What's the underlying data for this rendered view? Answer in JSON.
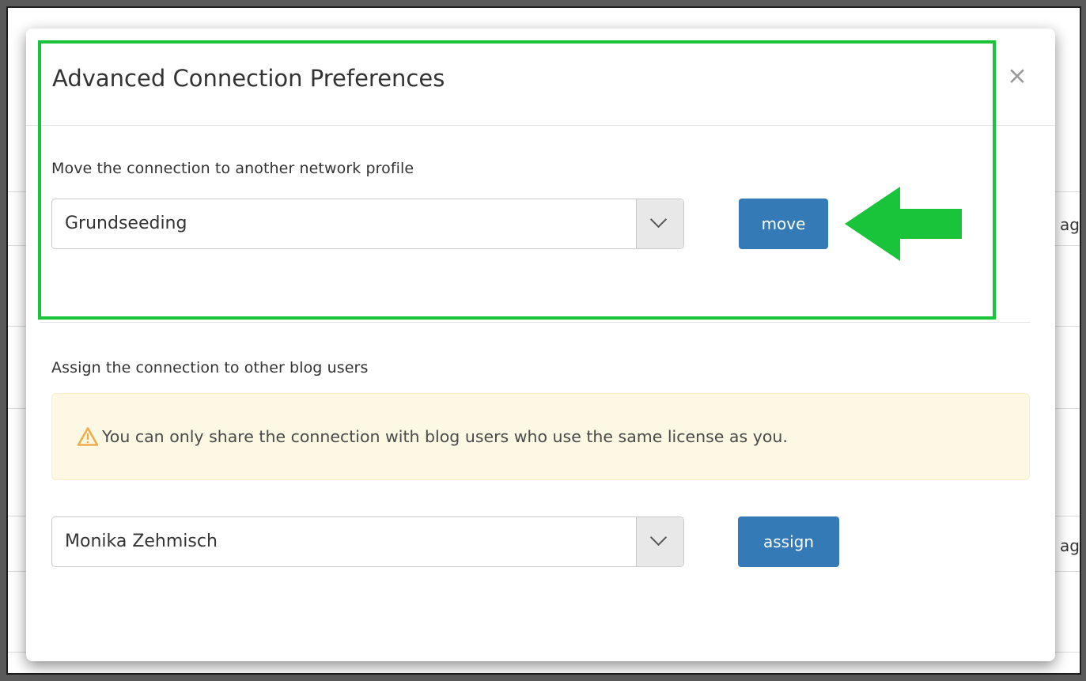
{
  "modal": {
    "title": "Advanced Connection Preferences",
    "close_label": "×"
  },
  "move_section": {
    "label": "Move the connection to another network profile",
    "selected_profile": "Grundseeding",
    "button_label": "move"
  },
  "assign_section": {
    "label": "Assign the connection to other blog users",
    "warning_text": "You can only share the connection with blog users who use the same license as you.",
    "selected_user": "Monika Zehmisch",
    "button_label": "assign"
  },
  "background": {
    "partial_text_1": "ag",
    "partial_text_2": "ag"
  },
  "colors": {
    "primary_button": "#337ab7",
    "highlight": "#19c43a",
    "warning_bg": "#fcf8e3",
    "warning_icon": "#f0ad4e"
  },
  "icons": {
    "close": "close-icon",
    "warning": "warning-triangle-icon",
    "dropdown": "chevron-down-icon",
    "annotation": "arrow-left-icon"
  }
}
